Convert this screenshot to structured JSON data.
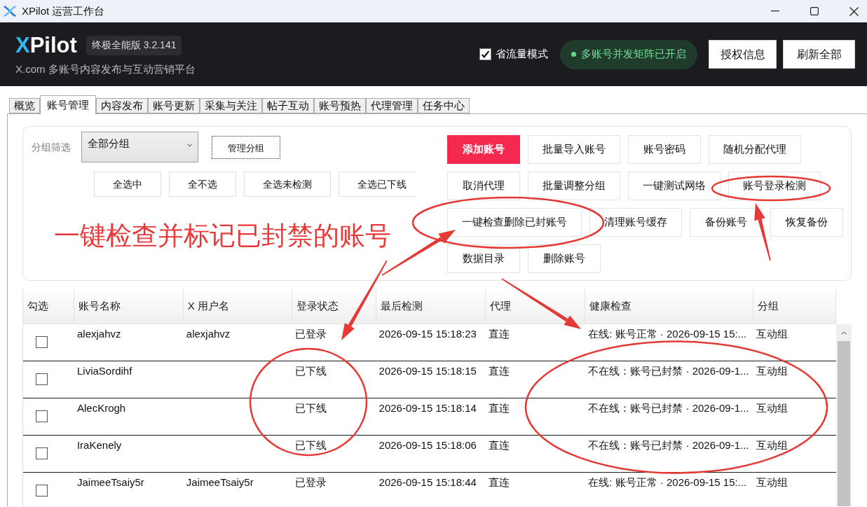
{
  "window": {
    "title": "XPilot 运营工作台"
  },
  "header": {
    "logo": {
      "accent": "X",
      "text": "Pilot"
    },
    "edition_badge": "终极全能版 3.2.141",
    "subtitle": "X.com 多账号内容发布与互动营销平台",
    "data_saver": {
      "label": "省流量模式",
      "checked": true
    },
    "status_pill": "多账号并发矩阵已开启",
    "buttons": [
      "授权信息",
      "刷新全部"
    ]
  },
  "tabs": [
    {
      "label": "概览",
      "selected": false
    },
    {
      "label": "账号管理",
      "selected": true
    },
    {
      "label": "内容发布",
      "selected": false
    },
    {
      "label": "账号更新",
      "selected": false
    },
    {
      "label": "采集与关注",
      "selected": false
    },
    {
      "label": "帖子互动",
      "selected": false
    },
    {
      "label": "账号预热",
      "selected": false
    },
    {
      "label": "代理管理",
      "selected": false
    },
    {
      "label": "任务中心",
      "selected": false
    }
  ],
  "toolbar": {
    "group_filter": {
      "label": "分组筛选",
      "value": "全部分组"
    },
    "manage_group_button": {
      "label": "管理分组",
      "focused": true
    },
    "selection_buttons": [
      "全选中",
      "全不选",
      "全选未检测",
      "全选已下线"
    ],
    "action_buttons": [
      {
        "label": "添加账号",
        "kind": "primary"
      },
      {
        "label": "批量导入账号",
        "kind": "normal"
      },
      {
        "label": "账号密码",
        "kind": "normal"
      },
      {
        "label": "随机分配代理",
        "kind": "normal"
      },
      {
        "label": "取消代理",
        "kind": "normal"
      },
      {
        "label": "批量调整分组",
        "kind": "normal"
      },
      {
        "label": "一键测试网络",
        "kind": "normal"
      },
      {
        "label": "账号登录检测",
        "kind": "normal"
      },
      {
        "label": "一键检查删除已封账号",
        "kind": "normal"
      },
      {
        "label": "清理账号缓存",
        "kind": "normal"
      },
      {
        "label": "备份账号",
        "kind": "normal"
      },
      {
        "label": "恢复备份",
        "kind": "normal"
      },
      {
        "label": "数据目录",
        "kind": "normal"
      },
      {
        "label": "删除账号",
        "kind": "normal"
      }
    ]
  },
  "annotation_caption": "一键检查并标记已封禁的账号",
  "table": {
    "columns": [
      "勾选",
      "账号名称",
      "X 用户名",
      "登录状态",
      "最后检测",
      "代理",
      "健康检查",
      "分组"
    ],
    "rows": [
      {
        "checked": false,
        "name": "alexjahvz",
        "x_username": "alexjahvz",
        "login_status": "已登录",
        "last_check": "2026-09-15 15:18:23",
        "proxy": "直连",
        "health": "在线: 账号正常 · 2026-09-15 15:...",
        "group": "互动组"
      },
      {
        "checked": false,
        "name": "LiviaSordihf",
        "login_status": "已下线",
        "last_check": "2026-09-15 15:18:15",
        "proxy": "直连",
        "health": "不在线：账号已封禁 · 2026-09-1...",
        "group": "互动组"
      },
      {
        "checked": false,
        "name": "AlecKrogh",
        "login_status": "已下线",
        "last_check": "2026-09-15 15:18:14",
        "proxy": "直连",
        "health": "不在线：账号已封禁 · 2026-09-1...",
        "group": "互动组"
      },
      {
        "checked": false,
        "name": "IraKenely",
        "login_status": "已下线",
        "last_check": "2026-09-15 15:18:06",
        "proxy": "直连",
        "health": "不在线：账号已封禁 · 2026-09-1...",
        "group": "互动组"
      },
      {
        "checked": false,
        "name": "JaimeeTsaiy5r",
        "x_username": "JaimeeTsaiy5r",
        "login_status": "已登录",
        "last_check": "2026-09-15 15:18:44",
        "proxy": "直连",
        "health": "在线: 账号正常 · 2026-09-15 15:...",
        "group": "互动组"
      }
    ]
  }
}
